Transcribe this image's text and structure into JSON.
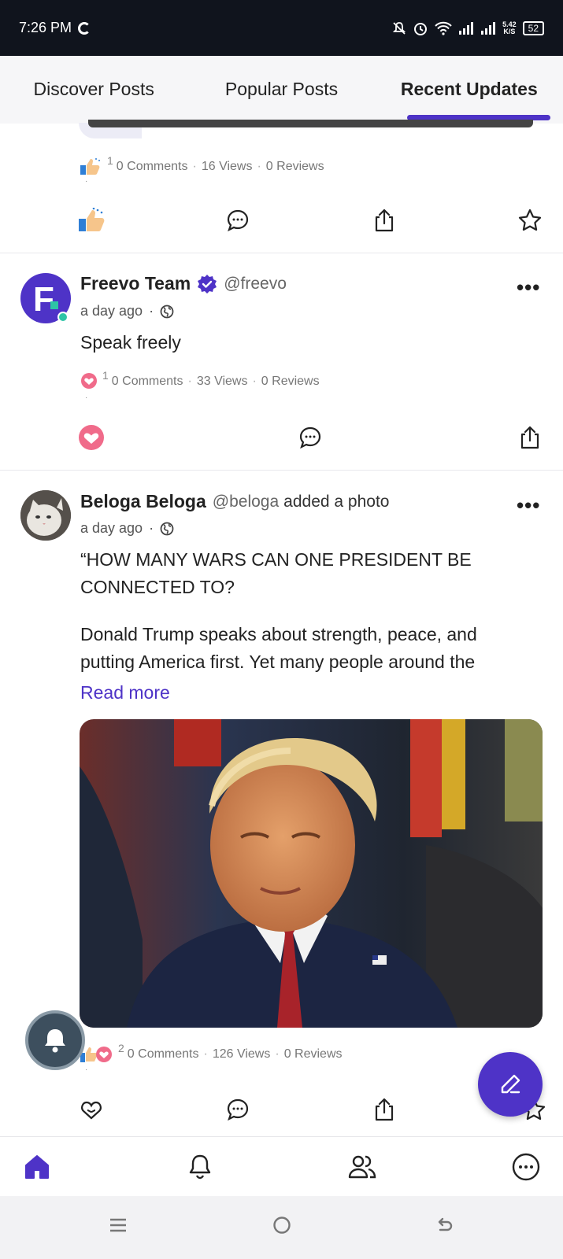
{
  "status_bar": {
    "time": "7:26 PM",
    "network_speed_top": "5.42",
    "network_speed_bottom": "K/S",
    "battery": "52"
  },
  "tabs": [
    {
      "label": "Discover Posts",
      "active": false
    },
    {
      "label": "Popular Posts",
      "active": false
    },
    {
      "label": "Recent Updates",
      "active": true
    }
  ],
  "post_fragment": {
    "reaction_count": "1",
    "comments": "0 Comments",
    "views": "16 Views",
    "reviews": "0 Reviews"
  },
  "post_freevo": {
    "avatar_letter": "F.",
    "name": "Freevo Team",
    "handle": "@freevo",
    "time": "a day ago",
    "body": "Speak freely",
    "reaction_count": "1",
    "comments": "0 Comments",
    "views": "33 Views",
    "reviews": "0 Reviews"
  },
  "post_beloga": {
    "name": "Beloga Beloga",
    "handle": "@beloga",
    "action": "added a photo",
    "time": "a day ago",
    "body_line1": "“HOW MANY WARS CAN ONE PRESIDENT BE",
    "body_line2": "CONNECTED TO?",
    "body_line3": "Donald Trump speaks about strength, peace, and",
    "body_line4": "putting America first. Yet many people around the",
    "read_more": "Read more",
    "reaction_count": "2",
    "comments": "0 Comments",
    "views": "126 Views",
    "reviews": "0 Reviews"
  },
  "separator": "·",
  "bottom_nav": [
    "home-icon",
    "bell-icon",
    "people-icon",
    "chat-icon"
  ],
  "colors": {
    "accent": "#4e33c7",
    "status_bar": "#10141d",
    "online": "#2ec4a6"
  }
}
